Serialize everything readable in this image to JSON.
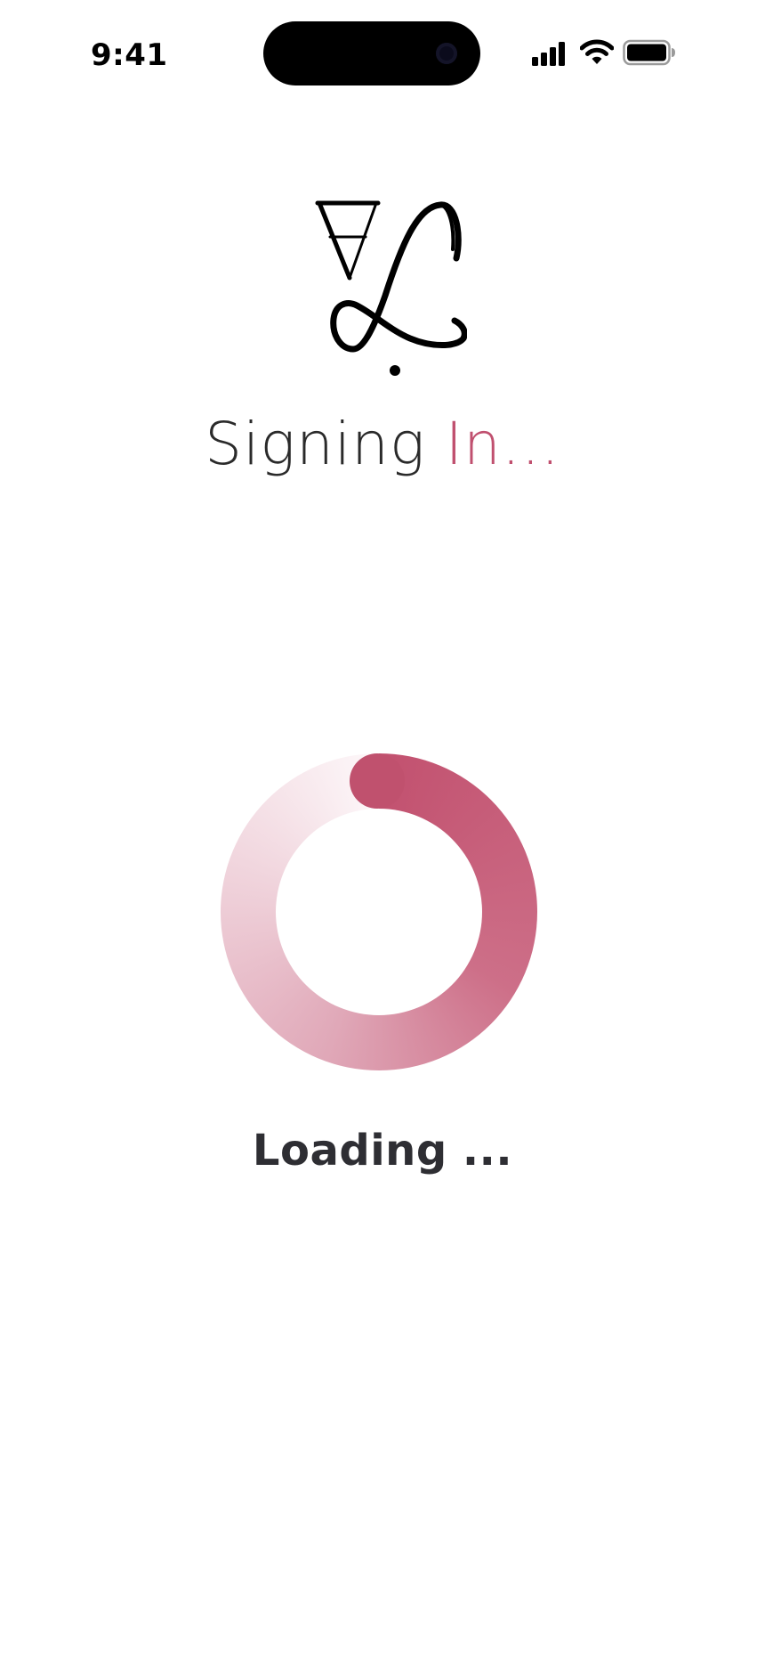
{
  "status_bar": {
    "time": "9:41",
    "icons": [
      "signal-icon",
      "wifi-icon",
      "battery-icon"
    ]
  },
  "logo": {
    "icon": "monogram-logo",
    "letters": "JA"
  },
  "heading": {
    "prefix": "Signing ",
    "accent": "In..."
  },
  "loading": {
    "text": "Loading ...",
    "icon": "spinner-icon"
  },
  "colors": {
    "accent": "#c0506f",
    "text_dark": "#2e2e33",
    "heading_text": "#2a2a2a",
    "background": "#ffffff"
  }
}
